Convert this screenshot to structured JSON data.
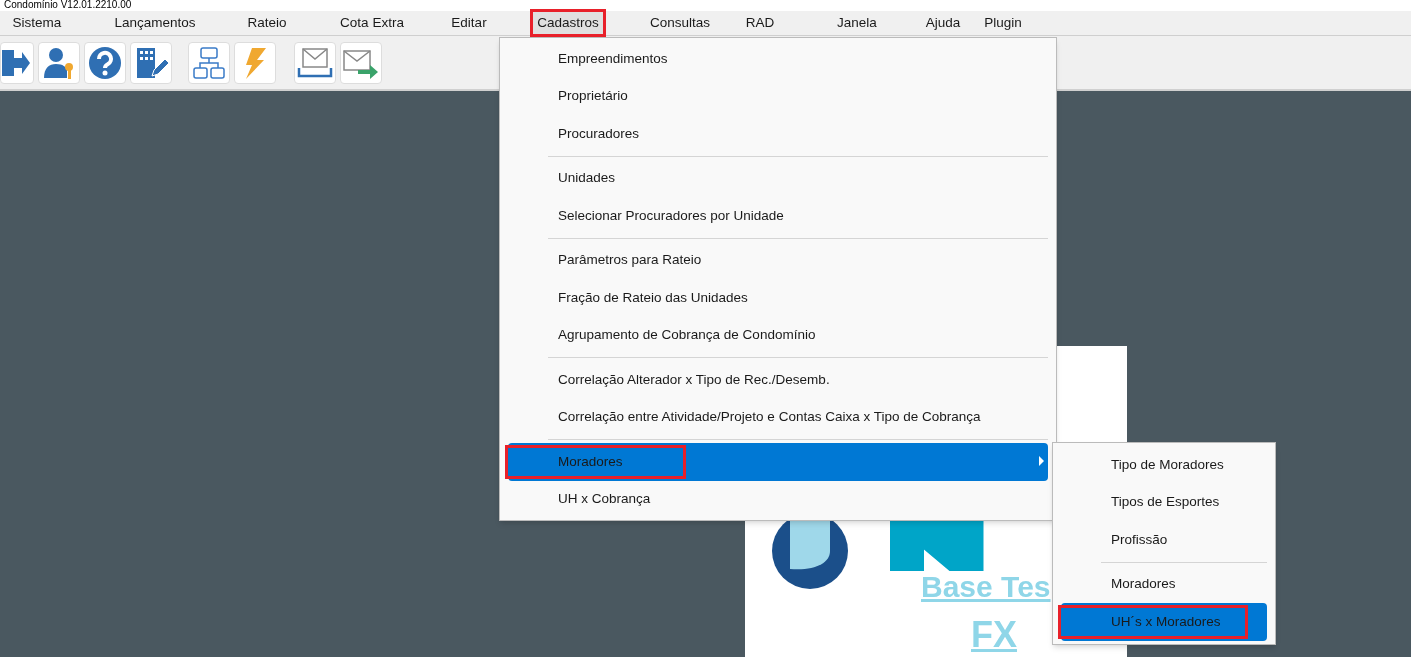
{
  "window": {
    "title": "Condomínio V12.01.2210.00"
  },
  "menubar": [
    {
      "label": "Sistema",
      "selected": false,
      "annotated": false
    },
    {
      "label": "Lançamentos",
      "selected": false,
      "annotated": false
    },
    {
      "label": "Rateio",
      "selected": false,
      "annotated": false
    },
    {
      "label": "Cota Extra",
      "selected": false,
      "annotated": false
    },
    {
      "label": "Editar",
      "selected": false,
      "annotated": false
    },
    {
      "label": "Cadastros",
      "selected": true,
      "annotated": true
    },
    {
      "label": "Consultas",
      "selected": false,
      "annotated": false
    },
    {
      "label": "RAD",
      "selected": false,
      "annotated": false
    },
    {
      "label": "Janela",
      "selected": false,
      "annotated": false
    },
    {
      "label": "Ajuda",
      "selected": false,
      "annotated": false
    },
    {
      "label": "Plugin",
      "selected": false,
      "annotated": false
    }
  ],
  "splash": {
    "subtitle": "Base Tes",
    "edition": "FX"
  },
  "menu": [
    {
      "kind": "item",
      "label": "Empreendimentos",
      "selected": false,
      "annotated": false,
      "submenu": false
    },
    {
      "kind": "item",
      "label": "Proprietário",
      "selected": false,
      "annotated": false,
      "submenu": false
    },
    {
      "kind": "item",
      "label": "Procuradores",
      "selected": false,
      "annotated": false,
      "submenu": false
    },
    {
      "kind": "separator"
    },
    {
      "kind": "item",
      "label": "Unidades",
      "selected": false,
      "annotated": false,
      "submenu": false
    },
    {
      "kind": "item",
      "label": "Selecionar Procuradores por Unidade",
      "selected": false,
      "annotated": false,
      "submenu": false
    },
    {
      "kind": "separator"
    },
    {
      "kind": "item",
      "label": "Parâmetros para Rateio",
      "selected": false,
      "annotated": false,
      "submenu": false
    },
    {
      "kind": "item",
      "label": "Fração de Rateio das Unidades",
      "selected": false,
      "annotated": false,
      "submenu": false
    },
    {
      "kind": "item",
      "label": "Agrupamento de Cobrança de Condomínio",
      "selected": false,
      "annotated": false,
      "submenu": false
    },
    {
      "kind": "separator"
    },
    {
      "kind": "item",
      "label": "Correlação Alterador x Tipo de Rec./Desemb.",
      "selected": false,
      "annotated": false,
      "submenu": false
    },
    {
      "kind": "item",
      "label": "Correlação entre Atividade/Projeto e Contas Caixa x Tipo de Cobrança",
      "selected": false,
      "annotated": false,
      "submenu": false
    },
    {
      "kind": "separator"
    },
    {
      "kind": "item",
      "label": "Moradores",
      "selected": true,
      "annotated": true,
      "submenu": true
    },
    {
      "kind": "item",
      "label": "UH x Cobrança",
      "selected": false,
      "annotated": false,
      "submenu": false
    }
  ],
  "submenu": [
    {
      "kind": "item",
      "label": "Tipo de Moradores",
      "selected": false,
      "annotated": false
    },
    {
      "kind": "item",
      "label": "Tipos de Esportes",
      "selected": false,
      "annotated": false
    },
    {
      "kind": "item",
      "label": "Profissão",
      "selected": false,
      "annotated": false
    },
    {
      "kind": "separator"
    },
    {
      "kind": "item",
      "label": "Moradores",
      "selected": false,
      "annotated": false
    },
    {
      "kind": "item",
      "label": "UH´s x Moradores",
      "selected": true,
      "annotated": true
    }
  ]
}
